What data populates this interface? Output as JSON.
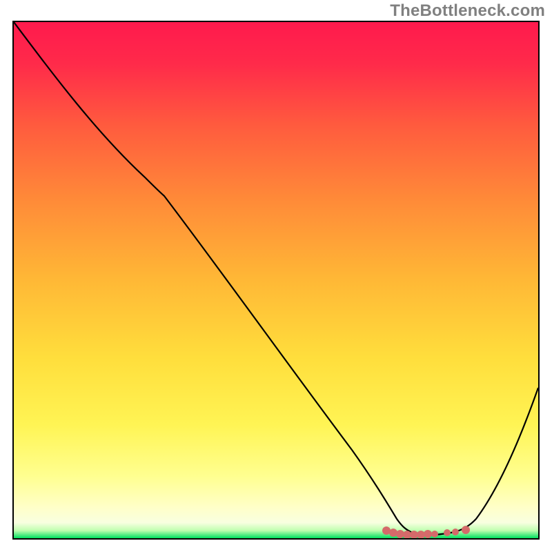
{
  "watermark": "TheBottleneck.com",
  "colors": {
    "border": "#000000",
    "curve": "#000000",
    "dots": "#d46a6a",
    "gradient_top": "#ff1a4d",
    "gradient_upper_mid": "#ffb030",
    "gradient_mid": "#ffe040",
    "gradient_lower_mid": "#ffff60",
    "gradient_near_bottom": "#ffffb0",
    "gradient_bottom": "#00e060"
  },
  "chart_data": {
    "type": "line",
    "title": "",
    "xlabel": "",
    "ylabel": "",
    "xlim": [
      0,
      100
    ],
    "ylim": [
      0,
      100
    ],
    "x": [
      0,
      10,
      20,
      25,
      30,
      40,
      50,
      60,
      65,
      70,
      72,
      75,
      78,
      80,
      85,
      100
    ],
    "values": [
      100,
      88,
      75,
      70,
      65,
      52,
      38,
      24,
      16,
      6,
      2,
      1,
      1,
      2,
      4,
      30
    ],
    "dots_region_x": [
      70,
      85
    ],
    "annotations": []
  }
}
